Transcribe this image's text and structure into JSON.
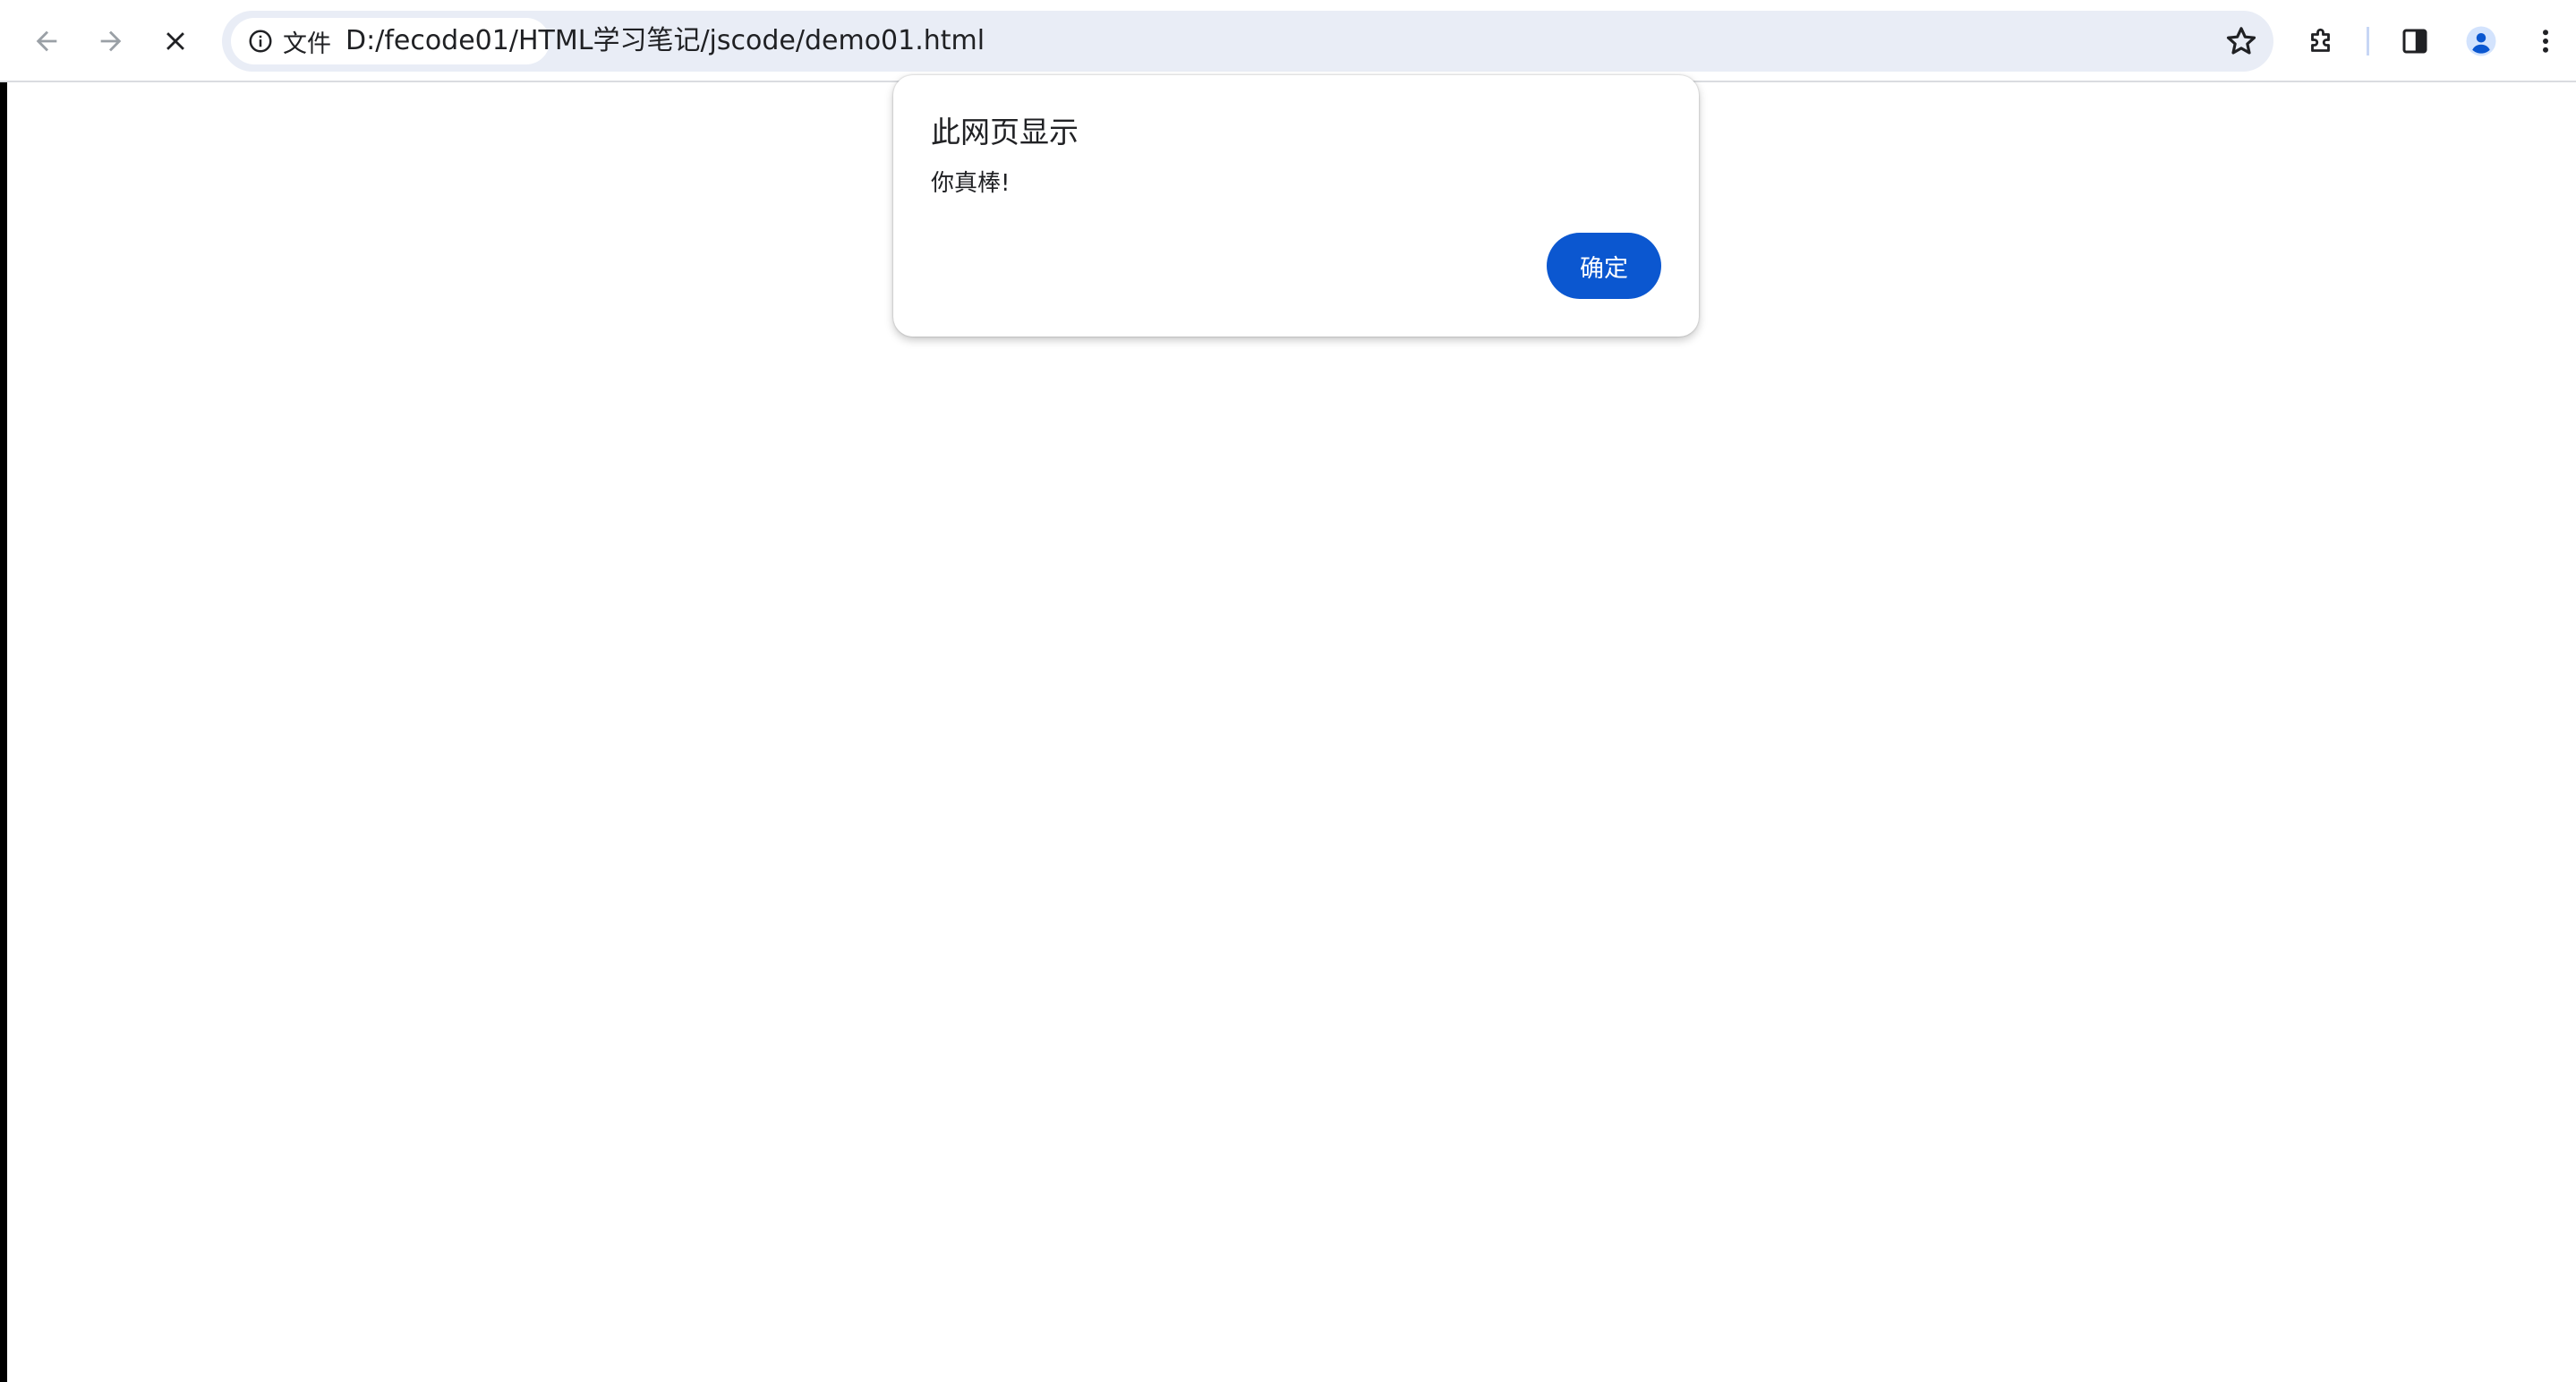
{
  "browser": {
    "nav": {
      "back_icon": "arrow-left-icon",
      "forward_icon": "arrow-right-icon",
      "stop_icon": "close-icon"
    },
    "omnibox": {
      "site_info_icon": "info-icon",
      "site_chip_label": "文件",
      "url": "D:/fecode01/HTML学习笔记/jscode/demo01.html",
      "bookmark_icon": "star-icon"
    },
    "toolbar_icons": [
      "extensions-icon",
      "side-panel-icon",
      "profile-avatar-icon",
      "more-menu-icon"
    ]
  },
  "dialog": {
    "title": "此网页显示",
    "message": "你真棒!",
    "ok_label": "确定"
  },
  "colors": {
    "accent": "#0b57d0",
    "omnibox_bg": "#e9edf6",
    "icon_gray": "#5f6368",
    "icon_disabled": "#9aa0a6"
  }
}
